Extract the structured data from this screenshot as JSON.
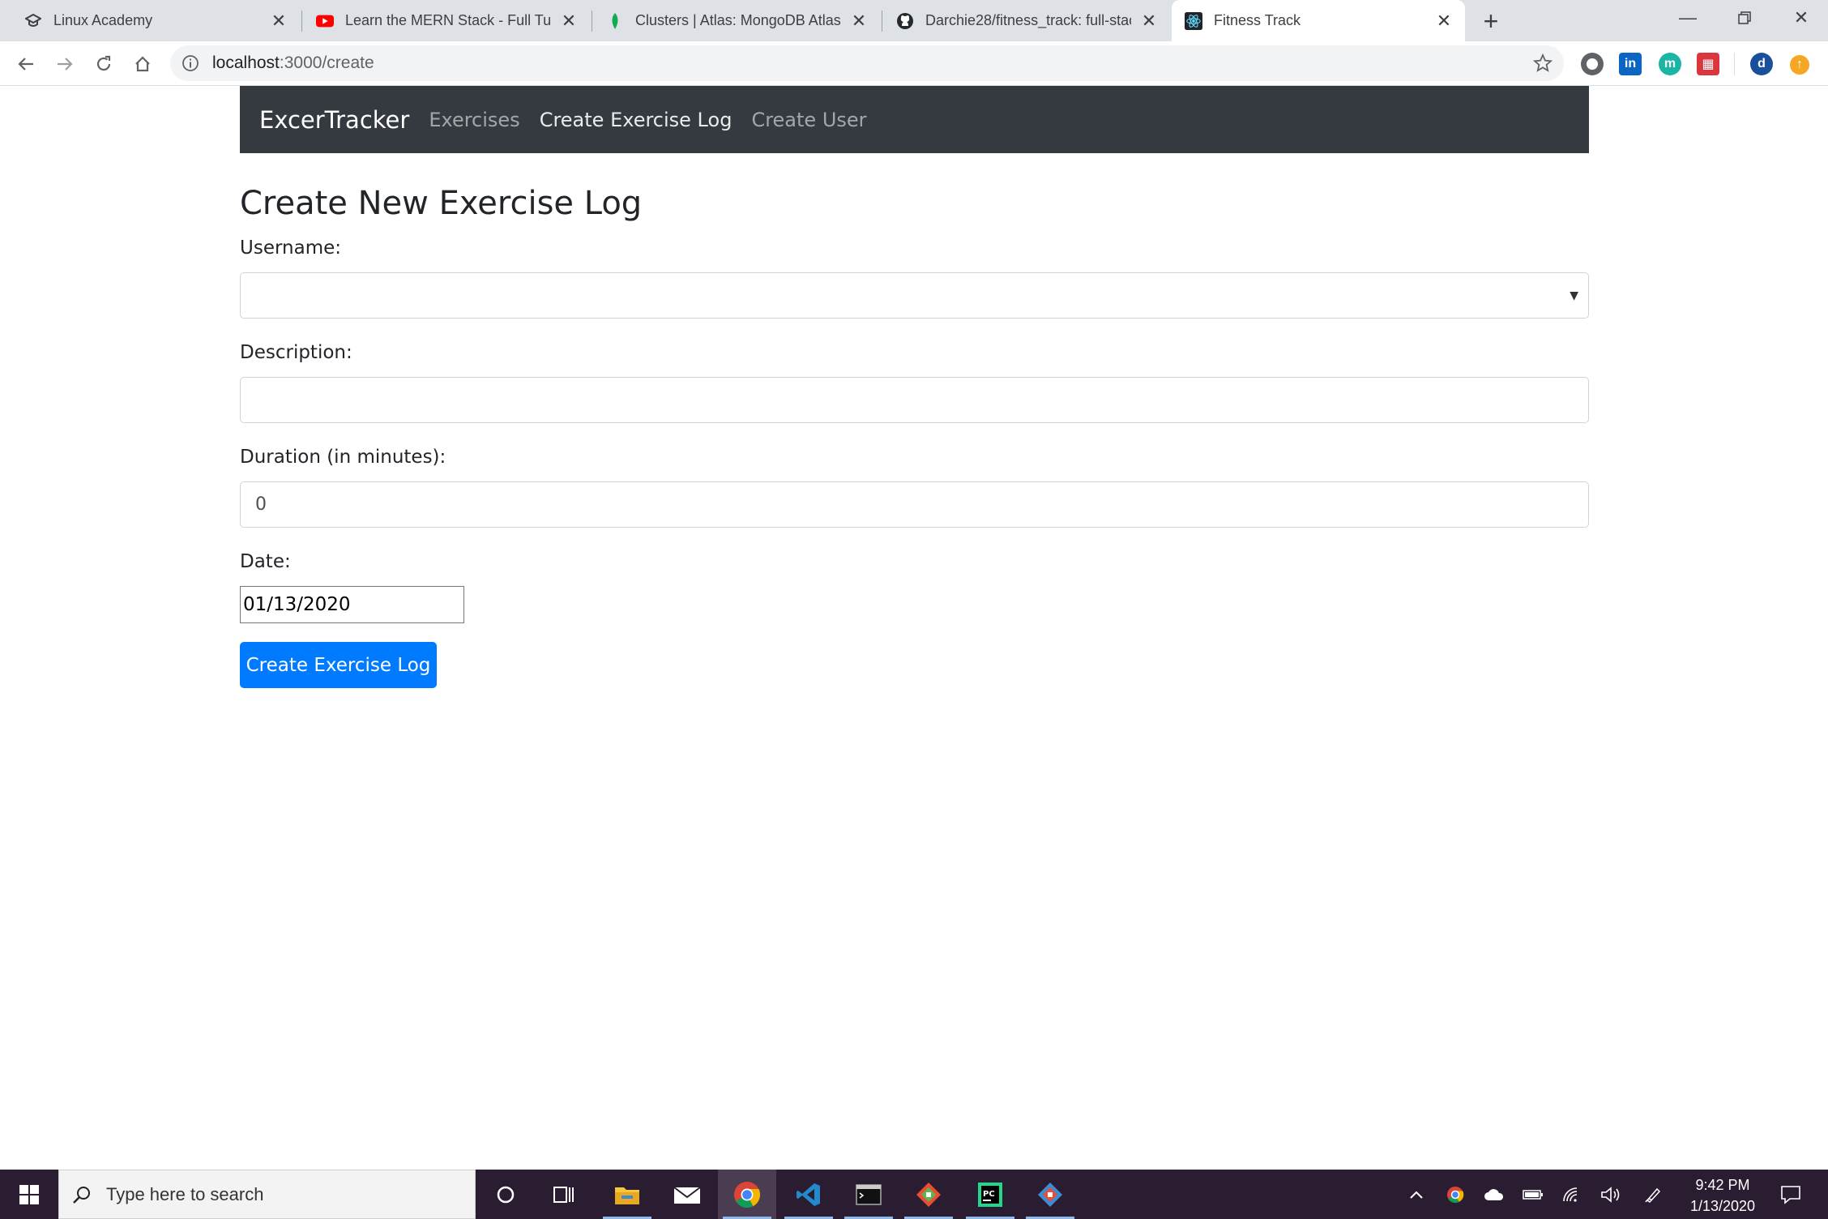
{
  "browser": {
    "tabs": [
      {
        "title": "Linux Academy",
        "icon": "graduation-cap-icon",
        "active": false
      },
      {
        "title": "Learn the MERN Stack - Full Tuto",
        "icon": "youtube-icon",
        "active": false
      },
      {
        "title": "Clusters | Atlas: MongoDB Atlas",
        "icon": "mongodb-leaf-icon",
        "active": false
      },
      {
        "title": "Darchie28/fitness_track: full-stack",
        "icon": "github-icon",
        "active": false
      },
      {
        "title": "Fitness Track",
        "icon": "react-icon",
        "active": true
      }
    ],
    "url_host": "localhost",
    "url_path": ":3000/create",
    "profile_initial": "d"
  },
  "app": {
    "brand": "ExcerTracker",
    "nav": {
      "exercises": "Exercises",
      "create_log": "Create Exercise Log",
      "create_user": "Create User"
    }
  },
  "form": {
    "heading": "Create New Exercise Log",
    "username_label": "Username:",
    "username_value": "",
    "description_label": "Description:",
    "description_value": "",
    "duration_label": "Duration (in minutes):",
    "duration_value": "0",
    "date_label": "Date:",
    "date_value": "01/13/2020",
    "submit_label": "Create Exercise Log"
  },
  "taskbar": {
    "search_placeholder": "Type here to search",
    "time": "9:42 PM",
    "date": "1/13/2020"
  },
  "colors": {
    "navbar": "#343a40",
    "primary": "#007bff",
    "taskbar": "#2b1d31"
  }
}
